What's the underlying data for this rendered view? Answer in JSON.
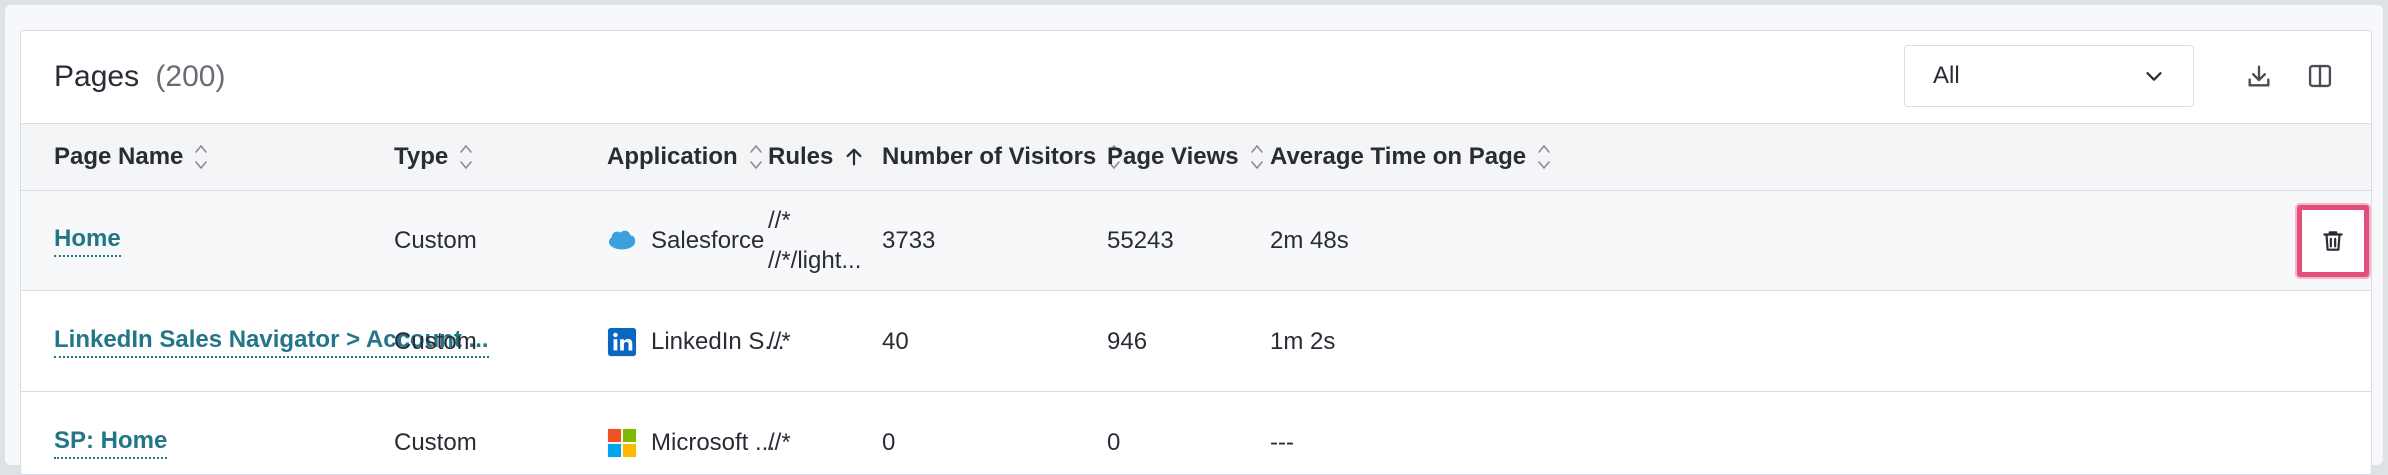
{
  "header": {
    "title": "Pages",
    "count": "(200)",
    "filter_value": "All"
  },
  "icons": {
    "download": "download-icon",
    "columns": "columns-icon",
    "delete": "trash-icon"
  },
  "columns": [
    {
      "label": "Page Name",
      "sort": "none"
    },
    {
      "label": "Type",
      "sort": "none"
    },
    {
      "label": "Application",
      "sort": "none"
    },
    {
      "label": "Rules",
      "sort": "ascending"
    },
    {
      "label": "Number of Visitors",
      "sort": "none"
    },
    {
      "label": "Page Views",
      "sort": "none"
    },
    {
      "label": "Average Time on Page",
      "sort": "none"
    }
  ],
  "rows": [
    {
      "name": "Home",
      "type": "Custom",
      "application": "Salesforce",
      "rules": [
        "//*",
        "//*/light..."
      ],
      "visitors": "3733",
      "views": "55243",
      "avg_time": "2m 48s"
    },
    {
      "name": "LinkedIn Sales Navigator > Account ...",
      "type": "Custom",
      "application": "LinkedIn S...",
      "rules": [
        "//*"
      ],
      "visitors": "40",
      "views": "946",
      "avg_time": "1m 2s"
    },
    {
      "name": "SP: Home",
      "type": "Custom",
      "application": "Microsoft ...",
      "rules": [
        "//*"
      ],
      "visitors": "0",
      "views": "0",
      "avg_time": "---"
    }
  ],
  "colors": {
    "link": "#227687",
    "highlight": "#e0507a",
    "salesforce": "#3ba0dd",
    "linkedin": "#0a66c2"
  }
}
